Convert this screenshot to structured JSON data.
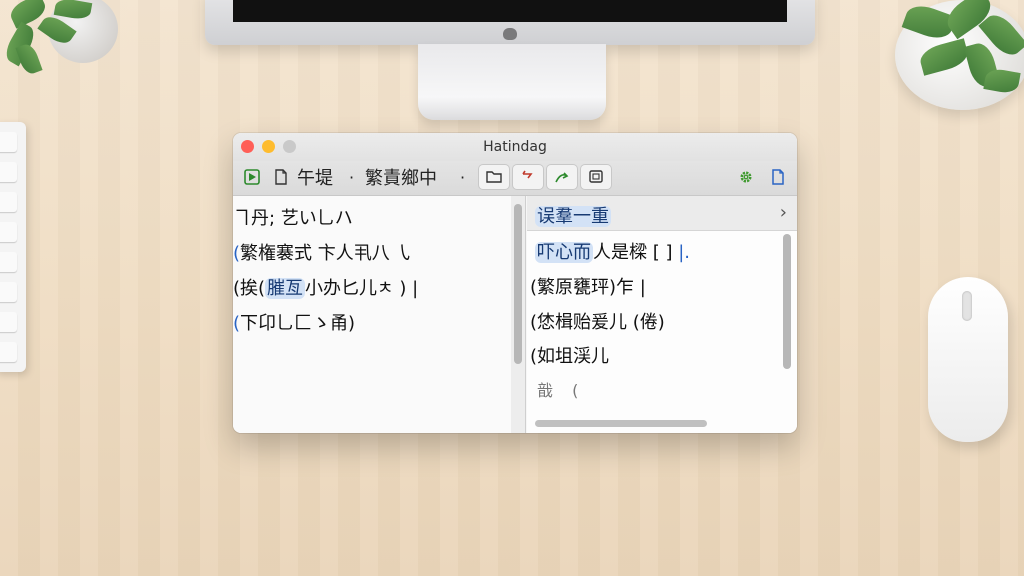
{
  "window": {
    "title": "Hatindag"
  },
  "toolbar": {
    "menu1_label": "午堤",
    "menu2_label": "繁責鄉中",
    "dropdown_glyph": "·"
  },
  "left_pane": {
    "lines": [
      {
        "prefix": "ヿ丹;",
        "highlight": "",
        "suffix": "艺い乚ハ"
      },
      {
        "prefix": "(",
        "highlight": "",
        "suffix": "繁権褰式 卞人丮八 ㇂"
      },
      {
        "prefix": "(挨(",
        "highlight": "膗亙",
        "suffix": "小办匕儿ㅊ ) |"
      },
      {
        "prefix": "(",
        "highlight": "",
        "suffix": "下卬乚匚ゝ甬)"
      }
    ]
  },
  "right_pane": {
    "header": "误羣一重",
    "lines": [
      {
        "highlight": "吓心而",
        "text": "人是樑 [ ]",
        "trail": "|."
      },
      {
        "highlight": "",
        "text": "(繁原甕玶)乍 |",
        "trail": ""
      },
      {
        "highlight": "",
        "text": "(恷楫贻爰儿 (倦)",
        "trail": ""
      },
      {
        "highlight": "",
        "text": "(如坥渓儿",
        "trail": ""
      },
      {
        "highlight": "",
        "text": "戠",
        "trail": "("
      }
    ],
    "chevron": "›"
  },
  "colors": {
    "accent_blue": "#2a64c4",
    "highlight_bg": "#d3e2f6",
    "close": "#ff5f57",
    "minimize": "#febc2e",
    "settings_green": "#3f9a2f"
  }
}
